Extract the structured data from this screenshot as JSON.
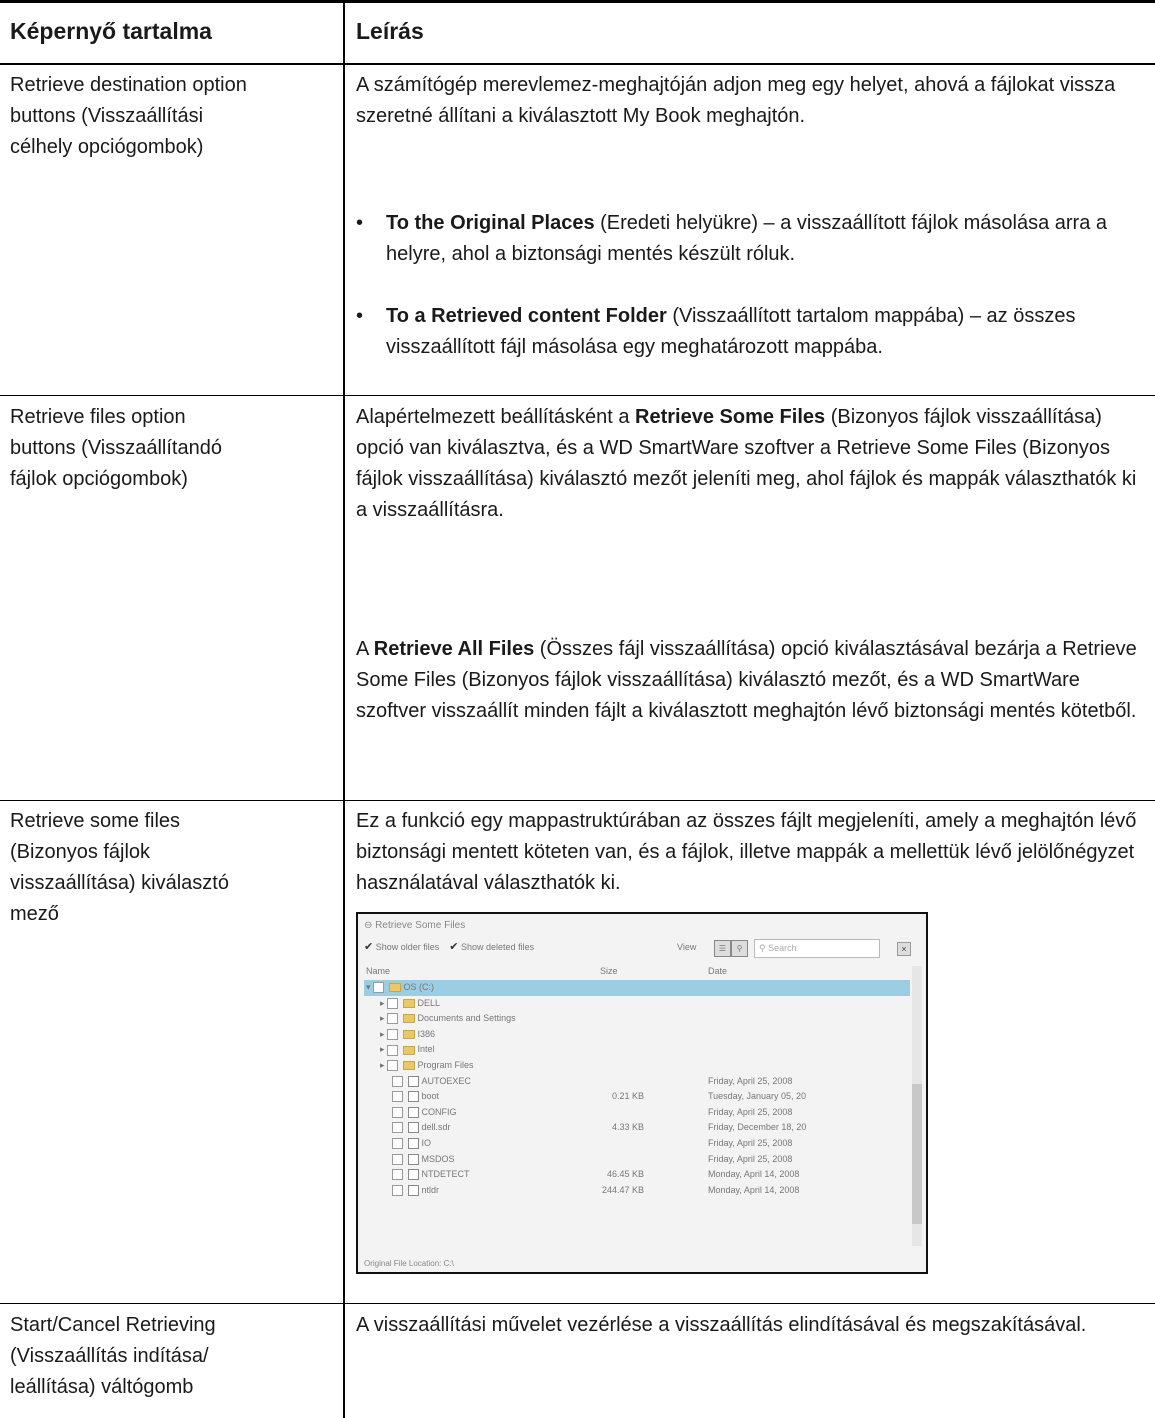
{
  "header": {
    "col1": "Képernyő tartalma",
    "col2": "Leírás"
  },
  "rows": [
    {
      "screen_item": [
        "Retrieve destination option",
        "buttons (Visszaállítási",
        "célhely opciógombok)"
      ],
      "desc": "A számítógép merevlemez-meghajtóján adjon meg egy helyet, ahová a fájlokat vissza szeretné állítani a kiválasztott My Book meghajtón.",
      "bullets": [
        {
          "bold": "To the Original Places",
          "text": " (Eredeti helyükre) – a visszaállított fájlok másolása arra a helyre, ahol a biztonsági mentés készült róluk."
        },
        {
          "bold": "To a Retrieved content Folder",
          "text": " (Visszaállított tartalom mappába) – az összes visszaállított fájl másolása egy meghatározott mappába."
        }
      ]
    },
    {
      "screen_item": [
        "Retrieve files option",
        "buttons (Visszaállítandó",
        "fájlok opciógombok)"
      ],
      "p1_pre": "Alapértelmezett beállításként a ",
      "p1_bold": "Retrieve Some Files",
      "p1_post": " (Bizonyos fájlok visszaállítása) opció van kiválasztva, és a WD SmartWare szoftver a Retrieve Some Files (Bizonyos fájlok visszaállítása) kiválasztó mezőt jeleníti meg, ahol fájlok és mappák választhatók ki a visszaállításra.",
      "p2_pre": "A ",
      "p2_bold": "Retrieve All Files",
      "p2_post": " (Összes fájl visszaállítása) opció kiválasztásával bezárja a Retrieve Some Files (Bizonyos fájlok visszaállítása) kiválasztó mezőt, és a WD SmartWare szoftver visszaállít minden fájlt a kiválasztott meghajtón lévő biztonsági mentés kötetből."
    },
    {
      "screen_item": [
        "Retrieve some files",
        "(Bizonyos fájlok",
        "visszaállítása) kiválasztó",
        "mező"
      ],
      "desc": "Ez a funkció egy mappastruktúrában az összes fájlt megjeleníti, amely a meghajtón lévő biztonsági mentett köteten van, és a fájlok, illetve mappák a mellettük lévő jelölőnégyzet használatával választhatók ki."
    },
    {
      "screen_item": [
        "Start/Cancel Retrieving",
        "(Visszaállítás indítása/",
        "leállítása) váltógomb"
      ],
      "desc": "A visszaállítási művelet vezérlése a visszaállítás elindításával és megszakításával."
    }
  ],
  "screenshot": {
    "title": "Retrieve Some Files",
    "show_older": "Show older files",
    "show_deleted": "Show deleted files",
    "view_label": "View",
    "search_placeholder": "Search",
    "col_name": "Name",
    "col_size": "Size",
    "col_date": "Date",
    "items": [
      {
        "name": "OS (C:)",
        "size": "",
        "date": "",
        "kind": "drive"
      },
      {
        "name": "DELL",
        "size": "",
        "date": "",
        "kind": "folder"
      },
      {
        "name": "Documents and Settings",
        "size": "",
        "date": "",
        "kind": "folder"
      },
      {
        "name": "I386",
        "size": "",
        "date": "",
        "kind": "folder"
      },
      {
        "name": "Intel",
        "size": "",
        "date": "",
        "kind": "folder"
      },
      {
        "name": "Program Files",
        "size": "",
        "date": "",
        "kind": "folder"
      },
      {
        "name": "AUTOEXEC",
        "size": "",
        "date": "Friday, April 25, 2008",
        "kind": "file"
      },
      {
        "name": "boot",
        "size": "0.21 KB",
        "date": "Tuesday, January 05, 20",
        "kind": "file"
      },
      {
        "name": "CONFIG",
        "size": "",
        "date": "Friday, April 25, 2008",
        "kind": "file"
      },
      {
        "name": "dell.sdr",
        "size": "4.33 KB",
        "date": "Friday, December 18, 20",
        "kind": "file"
      },
      {
        "name": "IO",
        "size": "",
        "date": "Friday, April 25, 2008",
        "kind": "file"
      },
      {
        "name": "MSDOS",
        "size": "",
        "date": "Friday, April 25, 2008",
        "kind": "file"
      },
      {
        "name": "NTDETECT",
        "size": "46.45 KB",
        "date": "Monday, April 14, 2008",
        "kind": "file"
      },
      {
        "name": "ntldr",
        "size": "244.47 KB",
        "date": "Monday, April 14, 2008",
        "kind": "file"
      }
    ],
    "footer": "Original File Location:  C:\\"
  }
}
